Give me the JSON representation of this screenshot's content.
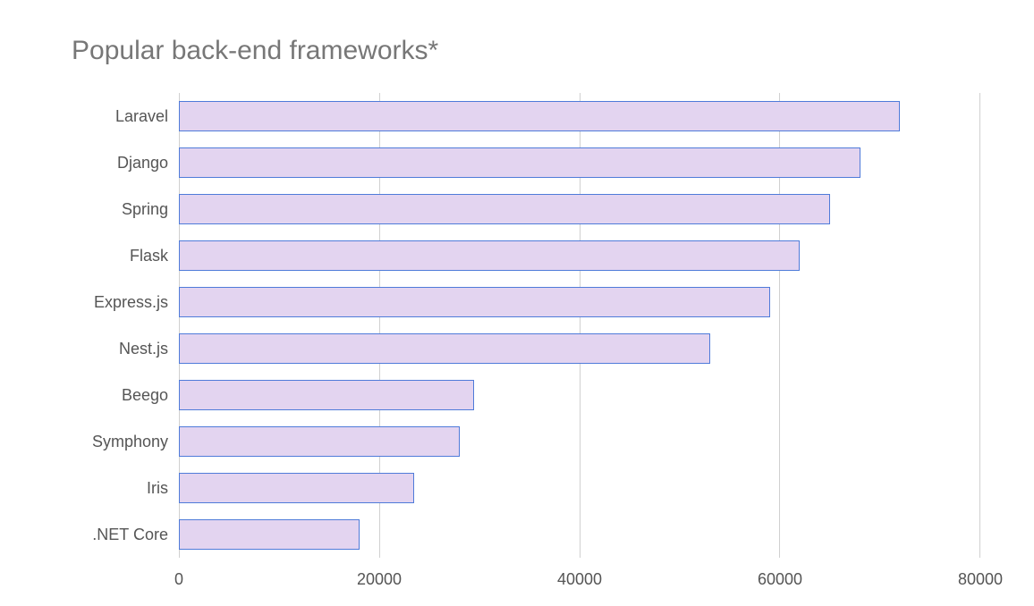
{
  "chart_data": {
    "type": "bar",
    "orientation": "horizontal",
    "title": "Popular back-end frameworks*",
    "xlabel": "",
    "ylabel": "",
    "xlim": [
      0,
      80000
    ],
    "x_ticks": [
      0,
      20000,
      40000,
      60000,
      80000
    ],
    "categories": [
      "Laravel",
      "Django",
      "Spring",
      "Flask",
      "Express.js",
      "Nest.js",
      "Beego",
      "Symphony",
      "Iris",
      ".NET Core"
    ],
    "values": [
      72000,
      68000,
      65000,
      62000,
      59000,
      53000,
      29500,
      28000,
      23500,
      18000
    ],
    "bar_color": "#e3d4f0",
    "bar_border": "#4f7bd9",
    "grid": true,
    "legend": false
  }
}
